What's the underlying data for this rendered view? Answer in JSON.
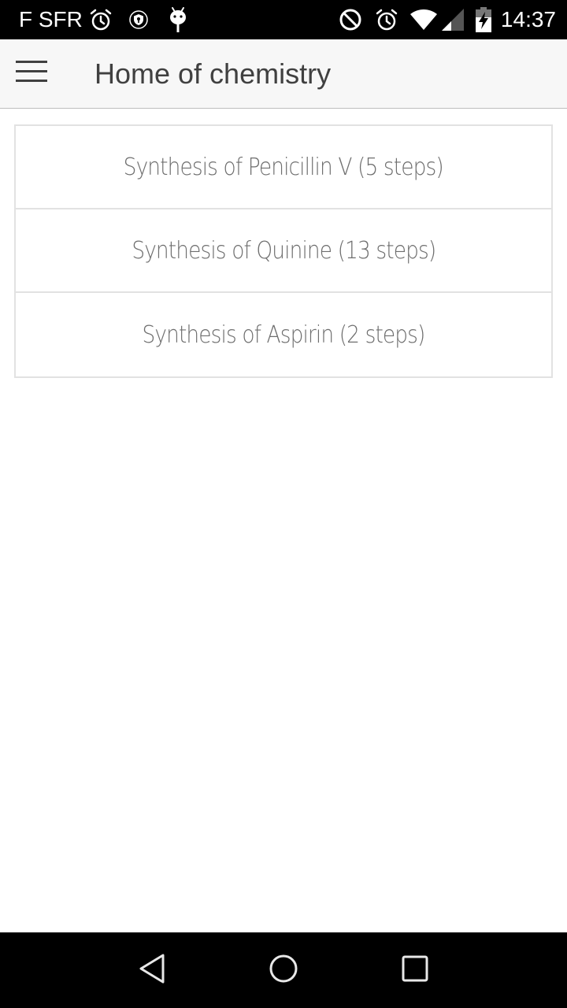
{
  "status_bar": {
    "carrier": "F SFR",
    "time": "14:37",
    "left_icons": [
      "alarm-icon",
      "shield-key-icon",
      "android-icon"
    ],
    "right_icons": [
      "do-not-disturb-icon",
      "alarm-icon",
      "wifi-icon",
      "cell-signal-icon",
      "battery-charging-icon"
    ]
  },
  "app_bar": {
    "menu_icon": "hamburger-menu-icon",
    "title": "Home of chemistry"
  },
  "list": {
    "items": [
      {
        "label": "Synthesis of Penicillin V (5 steps)"
      },
      {
        "label": "Synthesis of Quinine (13 steps)"
      },
      {
        "label": "Synthesis of Aspirin (2 steps)"
      }
    ]
  },
  "nav_bar": {
    "buttons": [
      "back-icon",
      "home-icon",
      "recents-icon"
    ]
  },
  "colors": {
    "status_bar_bg": "#000000",
    "app_bar_bg": "#f7f7f7",
    "title_text": "#404040",
    "list_border": "#e2e2e2",
    "list_text": "#6e6e6e",
    "nav_bar_bg": "#000000"
  }
}
